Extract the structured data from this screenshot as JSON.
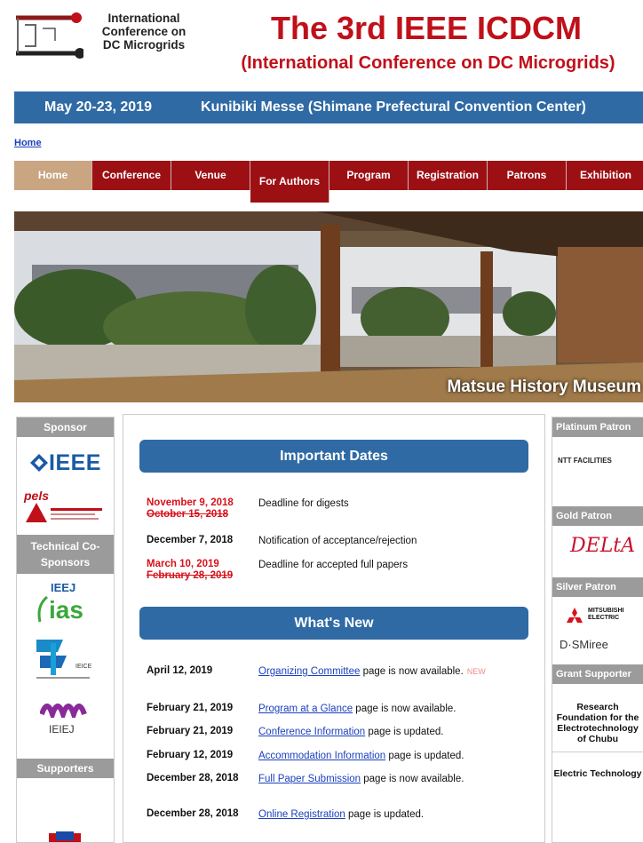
{
  "logo": {
    "line1": "International",
    "line2": "Conference on",
    "line3": "DC  Microgrids"
  },
  "header": {
    "title": "The 3rd IEEE ICDCM",
    "subtitle": "(International Conference on DC Microgrids)"
  },
  "datebar": {
    "dates": "May 20-23, 2019",
    "venue": "Kunibiki Messe  (Shimane Prefectural Convention Center)"
  },
  "breadcrumb": "Home",
  "nav": [
    "Home",
    "Conference",
    "Venue",
    "For Authors",
    "Program",
    "Registration",
    "Patrons",
    "Exhibition"
  ],
  "hero": {
    "caption": "Matsue History Museum"
  },
  "left": {
    "sponsor_head": "Sponsor",
    "ieee": "IEEE",
    "pels": "pels",
    "tech_head": "Technical Co-Sponsors",
    "ieej_logo": "IEEJ ias",
    "ieice": "IEICE",
    "ieiej": "IEIEJ",
    "supporters_head": "Supporters"
  },
  "important": {
    "title": "Important Dates",
    "rows": [
      {
        "date1": "November 9, 2018",
        "date2": "October 15, 2018",
        "desc": "Deadline for digests"
      },
      {
        "date1": "December 7, 2018",
        "date2": "",
        "desc": "Notification of acceptance/rejection"
      },
      {
        "date1": "March 10, 2019",
        "date2": "February 28, 2019",
        "desc": "Deadline for accepted full papers"
      }
    ]
  },
  "news": {
    "title": "What's New",
    "new_tag": "NEW",
    "rows": [
      {
        "date": "April 12, 2019",
        "link": "Organizing Committee",
        "rest": " page is now available."
      },
      {
        "date": "February 21, 2019",
        "link": "Program at a Glance",
        "rest": " page is now available."
      },
      {
        "date": "February 21, 2019",
        "link": "Conference Information",
        "rest": " page is updated."
      },
      {
        "date": "February 12, 2019",
        "link": "Accommodation Information",
        "rest": " page is updated."
      },
      {
        "date": "December 28, 2018",
        "link": "Full Paper Submission",
        "rest": " page is now available."
      },
      {
        "date": "December 28, 2018",
        "link": "Online Registration",
        "rest": " page is updated."
      }
    ]
  },
  "right": {
    "platinum_head": "Platinum Patron",
    "ntt": "NTT FACILITIES",
    "gold_head": "Gold Patron",
    "delta": "DELtA",
    "silver_head": "Silver Patron",
    "mitsubishi": "MITSUBISHI ELECTRIC",
    "dsmiree": "D·SMiree",
    "grant_head": "Grant Supporter",
    "grant_text": "Research Foundation for the Electrotechnology of Chubu",
    "electric": "Electric Technology"
  },
  "colors": {
    "brand_red": "#c0101a",
    "nav_red": "#9c1014",
    "nav_home": "#c9a582",
    "blue_bar": "#2f6aa5",
    "gray_head": "#9b9b9b"
  }
}
